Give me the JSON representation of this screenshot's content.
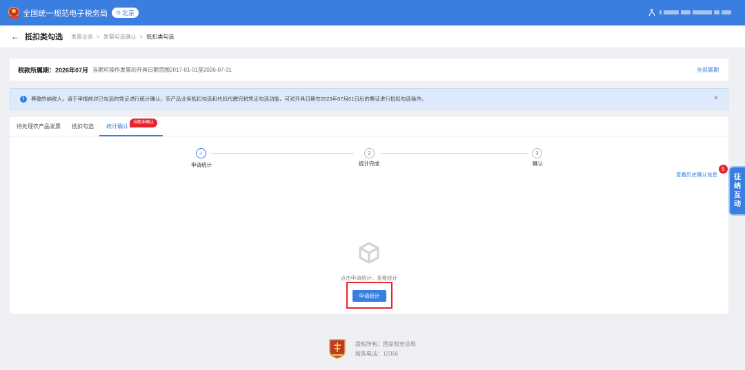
{
  "header": {
    "site_title": "全国统一规范电子税务局",
    "region": "北京"
  },
  "breadcrumb": {
    "page_title": "抵扣类勾选",
    "items": [
      "发票业务",
      "发票勾选确认",
      "抵扣类勾选"
    ],
    "separator": ">"
  },
  "period": {
    "label": "税款所属期：",
    "value": "2026年07月",
    "range_text": "当期可操作发票的开具日期范围2017-01-01至2026-07-31",
    "all_periods_link": "全部属期"
  },
  "notice": {
    "text": "尊敬的纳税人，请于申报前对已勾选的凭证进行统计确认。农产品业务抵扣勾选和代扣代缴完税凭证勾选功能，可对开具日期在2023年07月01日后的票证进行抵扣勾选操作。",
    "close": "×"
  },
  "tabs": [
    {
      "label": "待处理农产品发票",
      "active": false
    },
    {
      "label": "抵扣勾选",
      "active": false
    },
    {
      "label": "统计确认",
      "active": true,
      "badge": "当期未确认"
    }
  ],
  "steps": [
    {
      "number": "✓",
      "label": "申请统计",
      "done": true
    },
    {
      "number": "2",
      "label": "统计完成",
      "done": false
    },
    {
      "number": "3",
      "label": "确认",
      "done": false
    }
  ],
  "history": {
    "link": "查看历史确认信息",
    "badge": "5"
  },
  "empty_state": {
    "text": "点击申请统计，查看统计",
    "button": "申请统计"
  },
  "side_widget": {
    "chars": [
      "征",
      "纳",
      "互",
      "动"
    ]
  },
  "footer": {
    "copyright": "版权所有：国家税务总局",
    "hotline": "服务电话：12366"
  },
  "colors": {
    "primary": "#3a7ee0",
    "badge_red": "#e8232d",
    "notice_bg": "#dceafc"
  }
}
